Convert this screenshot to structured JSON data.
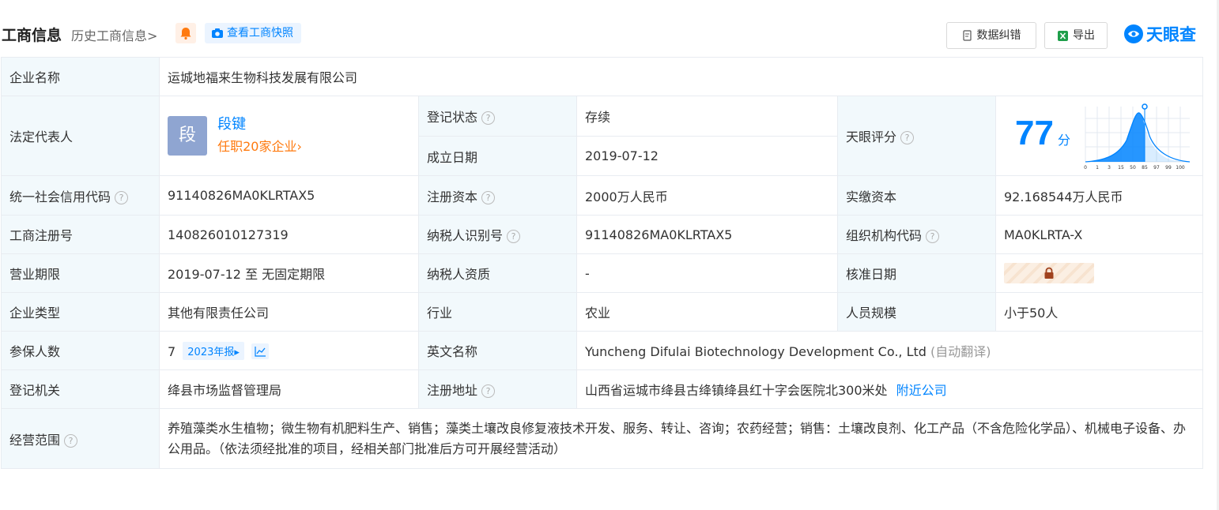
{
  "header": {
    "title": "工商信息",
    "history_link": "历史工商信息>",
    "snapshot_label": "查看工商快照",
    "correct_button": "数据纠错",
    "export_button": "导出",
    "logo_text": "天眼查"
  },
  "colors": {
    "accent": "#0084ff",
    "status_green": "#12a544",
    "orange": "#ff7a0f",
    "label_bg": "#f2f9fc"
  },
  "rows": {
    "company_name": {
      "label": "企业名称",
      "value": "运城地福来生物科技发展有限公司"
    },
    "legal_rep": {
      "label": "法定代表人",
      "avatar_char": "段",
      "name": "段键",
      "positions": "任职20家企业›"
    },
    "reg_status": {
      "label": "登记状态",
      "value": "存续"
    },
    "founded": {
      "label": "成立日期",
      "value": "2019-07-12"
    },
    "score": {
      "label": "天眼评分",
      "value": "77",
      "unit": "分",
      "axis_ticks": [
        "0",
        "1",
        "3",
        "15",
        "50",
        "85",
        "97",
        "99",
        "100"
      ]
    },
    "credit_code": {
      "label": "统一社会信用代码",
      "value": "91140826MA0KLRTAX5"
    },
    "reg_capital": {
      "label": "注册资本",
      "value": "2000万人民币"
    },
    "paid_capital": {
      "label": "实缴资本",
      "value": "92.168544万人民币"
    },
    "reg_number": {
      "label": "工商注册号",
      "value": "140826010127319"
    },
    "taxpayer_id": {
      "label": "纳税人识别号",
      "value": "91140826MA0KLRTAX5"
    },
    "org_code": {
      "label": "组织机构代码",
      "value": "MA0KLRTA-X"
    },
    "term": {
      "label": "营业期限",
      "value": "2019-07-12 至 无固定期限"
    },
    "taxpayer_qual": {
      "label": "纳税人资质",
      "value": "-"
    },
    "approval_date": {
      "label": "核准日期"
    },
    "company_type": {
      "label": "企业类型",
      "value": "其他有限责任公司"
    },
    "industry": {
      "label": "行业",
      "value": "农业"
    },
    "staff_size": {
      "label": "人员规模",
      "value": "小于50人"
    },
    "insured": {
      "label": "参保人数",
      "value": "7",
      "report": "2023年报▸"
    },
    "english_name": {
      "label": "英文名称",
      "value": "Yuncheng Difulai Biotechnology Development Co., Ltd",
      "note": "(自动翻译)"
    },
    "authority": {
      "label": "登记机关",
      "value": "绛县市场监督管理局"
    },
    "address": {
      "label": "注册地址",
      "value": "山西省运城市绛县古绛镇绛县红十字会医院北300米处",
      "link": "附近公司"
    },
    "scope": {
      "label": "经营范围",
      "value": "养殖藻类水生植物；微生物有机肥料生产、销售；藻类土壤改良修复液技术开发、服务、转让、咨询；农药经营；销售：土壤改良剂、化工产品（不含危险化学品）、机械电子设备、办公用品。（依法须经批准的项目，经相关部门批准后方可开展经营活动）"
    }
  }
}
